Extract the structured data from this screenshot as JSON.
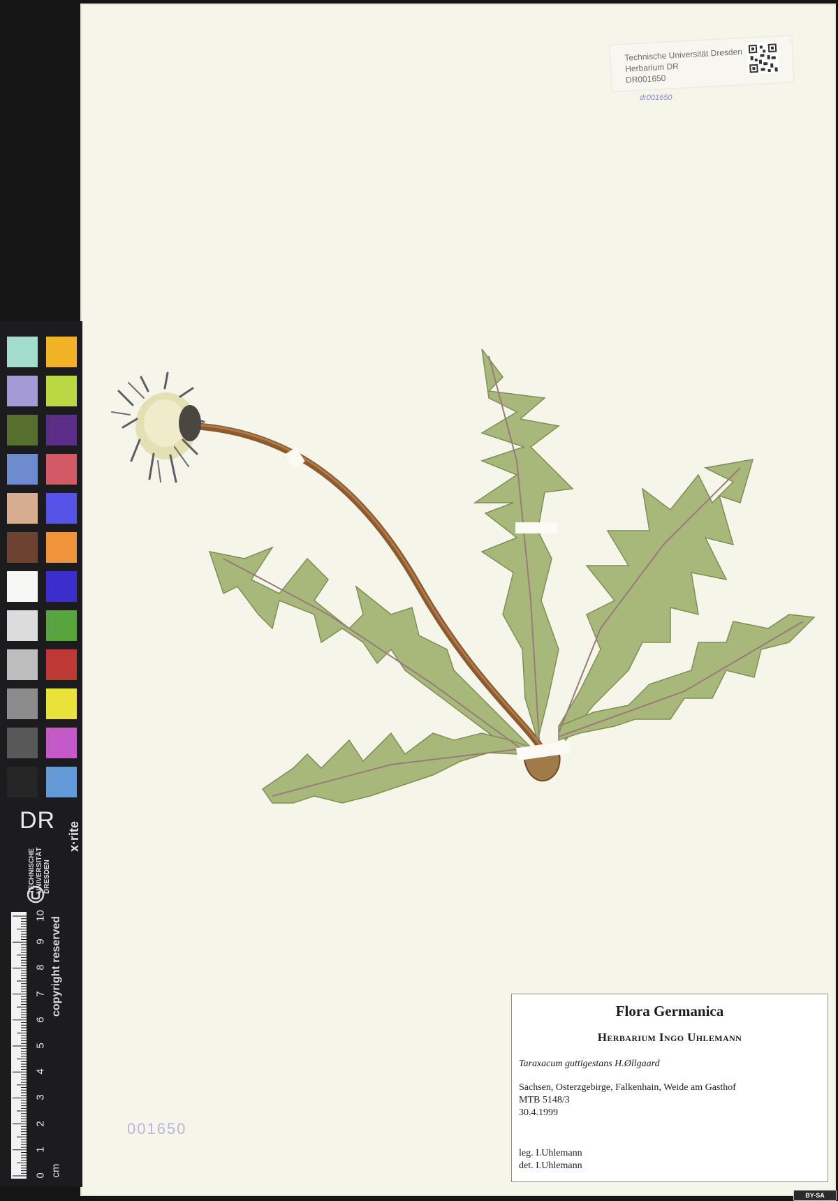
{
  "institution_label": {
    "line1": "Technische Universität Dresden",
    "line2": "Herbarium DR",
    "line3": "DR001650"
  },
  "stamp_mark": "dr001650",
  "barcode_number": "001650",
  "sidebar": {
    "logo_text": "DR",
    "brand": "x·rite",
    "university_lines": [
      "TECHNISCHE",
      "UNIVERSITÄT",
      "DRESDEN"
    ],
    "copyright": "copyright reserved",
    "ruler_unit": "cm",
    "ruler_ticks": [
      "0",
      "1",
      "2",
      "3",
      "4",
      "5",
      "6",
      "7",
      "8",
      "9",
      "10"
    ],
    "swatch_colors": [
      [
        "#a3dccb",
        "#f1b227"
      ],
      [
        "#a49ad6",
        "#bbd744"
      ],
      [
        "#566f2f",
        "#5c2e87"
      ],
      [
        "#6f8bd0",
        "#d25a66"
      ],
      [
        "#d7ad92",
        "#5753e6"
      ],
      [
        "#6e4230",
        "#ef943a"
      ],
      [
        "#f6f6f4",
        "#3a2fcd"
      ],
      [
        "#dcdcdc",
        "#58a540"
      ],
      [
        "#bdbdbd",
        "#bc3a33"
      ],
      [
        "#8c8c8c",
        "#e9e23a"
      ],
      [
        "#585858",
        "#c35ac7"
      ],
      [
        "#262626",
        "#6499d8"
      ]
    ]
  },
  "flora_label": {
    "title": "Flora Germanica",
    "herbarium": "Herbarium Ingo Uhlemann",
    "species": "Taraxacum  guttigestans H.Øllgaard",
    "locality": "Sachsen, Osterzgebirge, Falkenhain, Weide am Gasthof",
    "grid": "MTB 5148/3",
    "date": "30.4.1999",
    "collector": "leg. I.Uhlemann",
    "determiner": "det. I.Uhlemann"
  },
  "license_badge": "BY-SA",
  "colors": {
    "sheet": "#f6f5ea",
    "leaf": "#a8b77a",
    "stem": "#8b5a2e"
  }
}
